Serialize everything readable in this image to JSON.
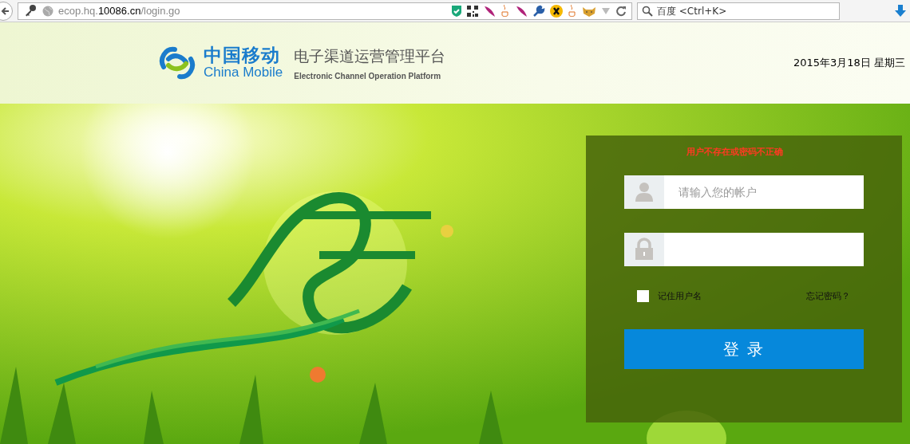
{
  "browser": {
    "url": "ecop.hq.**10086.cn**/login.go",
    "search": {
      "placeholder": "百度 <Ctrl+K>"
    }
  },
  "header": {
    "logo_cn": "中国移动",
    "logo_en": "China Mobile",
    "platform_cn": "电子渠道运营管理平台",
    "platform_en": "Electronic Channel Operation Platform",
    "date": "2015年3月18日 星期三"
  },
  "login": {
    "error": "用户不存在或密码不正确",
    "username": {
      "placeholder": "请输入您的帐户"
    },
    "remember": {
      "label": "记住用户名",
      "checked": false
    },
    "forgot": "忘记密码？",
    "submit": "登 录"
  }
}
